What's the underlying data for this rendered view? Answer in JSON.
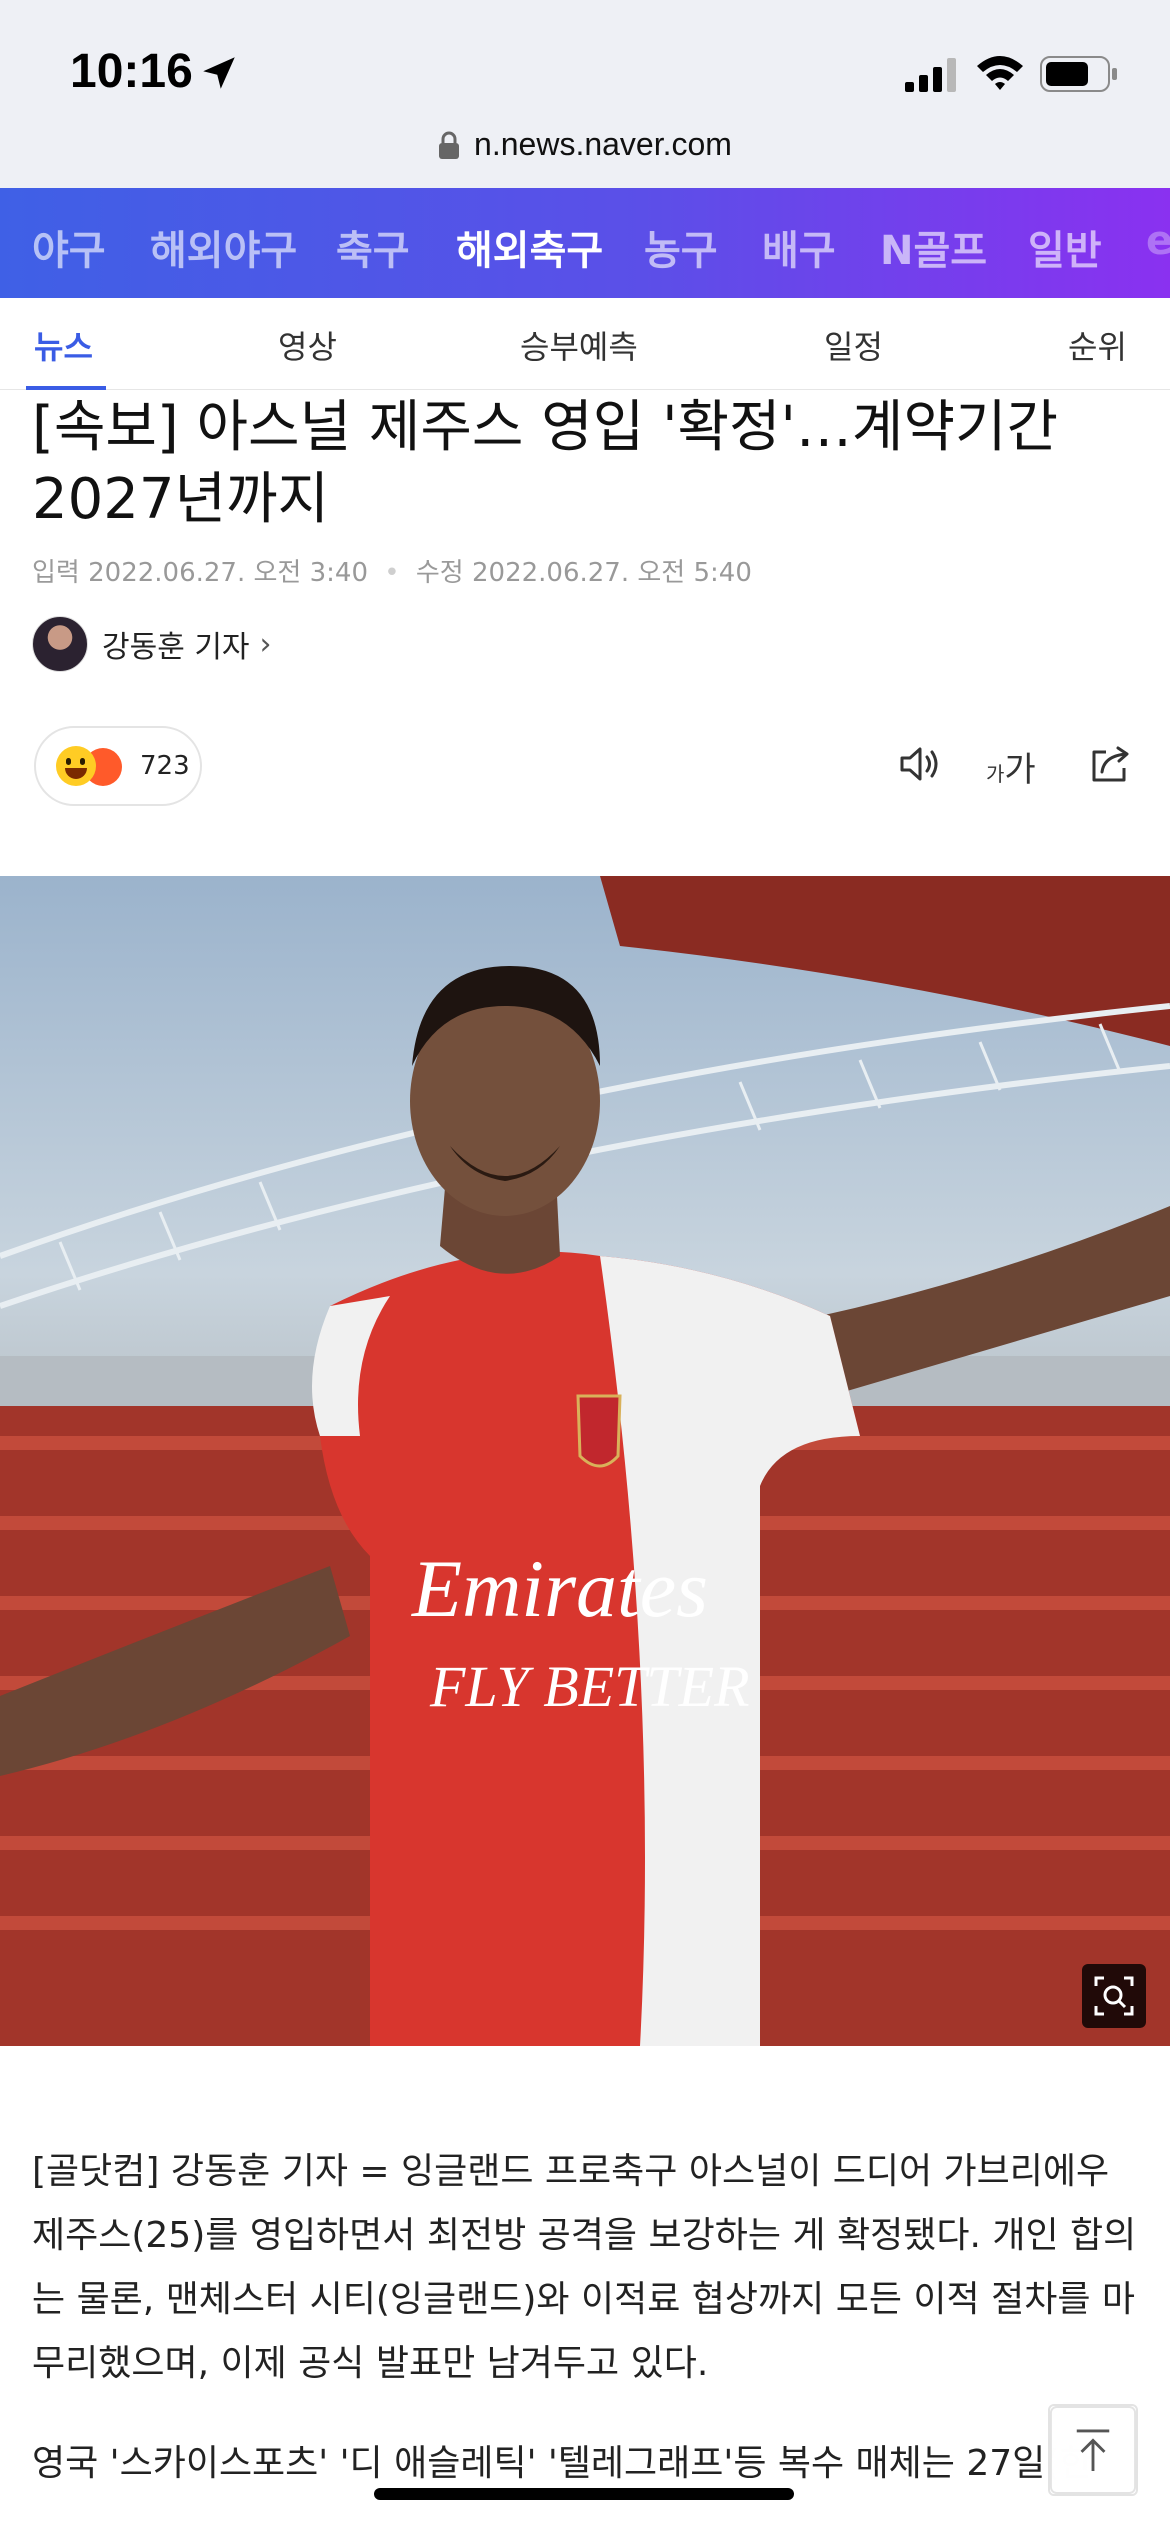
{
  "status_bar": {
    "time": "10:16",
    "icons": [
      "location-arrow-icon",
      "signal-icon",
      "wifi-icon",
      "battery-icon"
    ]
  },
  "browser": {
    "url": "n.news.naver.com",
    "lock_icon": "lock-icon"
  },
  "sport_nav": {
    "items": [
      "야구",
      "해외야구",
      "축구",
      "해외축구",
      "농구",
      "배구",
      "N골프",
      "일반",
      "e"
    ],
    "active": "해외축구",
    "colors": {
      "start": "#3f60e6",
      "end": "#8a31f0"
    }
  },
  "sub_tabs": {
    "items": [
      "뉴스",
      "영상",
      "승부예측",
      "일정",
      "순위"
    ],
    "active": "뉴스",
    "accent": "#3a5ce5"
  },
  "article": {
    "headline": "[속보] 아스널 제주스 영입 '확정'…계약기간 2027년까지",
    "input_label": "입력",
    "input_date": "2022.06.27. 오전 3:40",
    "edit_label": "수정",
    "edit_date": "2022.06.27. 오전 5:40",
    "reporter": "강동훈 기자",
    "reaction_count": "723",
    "tools": [
      "speaker-icon",
      "font-size-icon",
      "share-icon"
    ],
    "font_size_small": "가",
    "font_size_large": "가",
    "photo_jersey_text_1": "Emirates",
    "photo_jersey_text_2": "FLY BETTER",
    "paragraphs": [
      "[골닷컴] 강동훈 기자 = 잉글랜드 프로축구 아스널이 드디어 가브리에우 제주스(25)를 영입하면서 최전방 공격을 보강하는 게 확정됐다. 개인 합의는 물론, 맨체스터 시티(잉글랜드)와 이적료 협상까지 모든 이적 절차를 마무리했으며, 이제 공식 발표만 남겨두고 있다.",
      "영국 '스카이스포츠' '디 애슬레틱' '텔레그래프'등 복수 매체는 27일(한"
    ]
  }
}
